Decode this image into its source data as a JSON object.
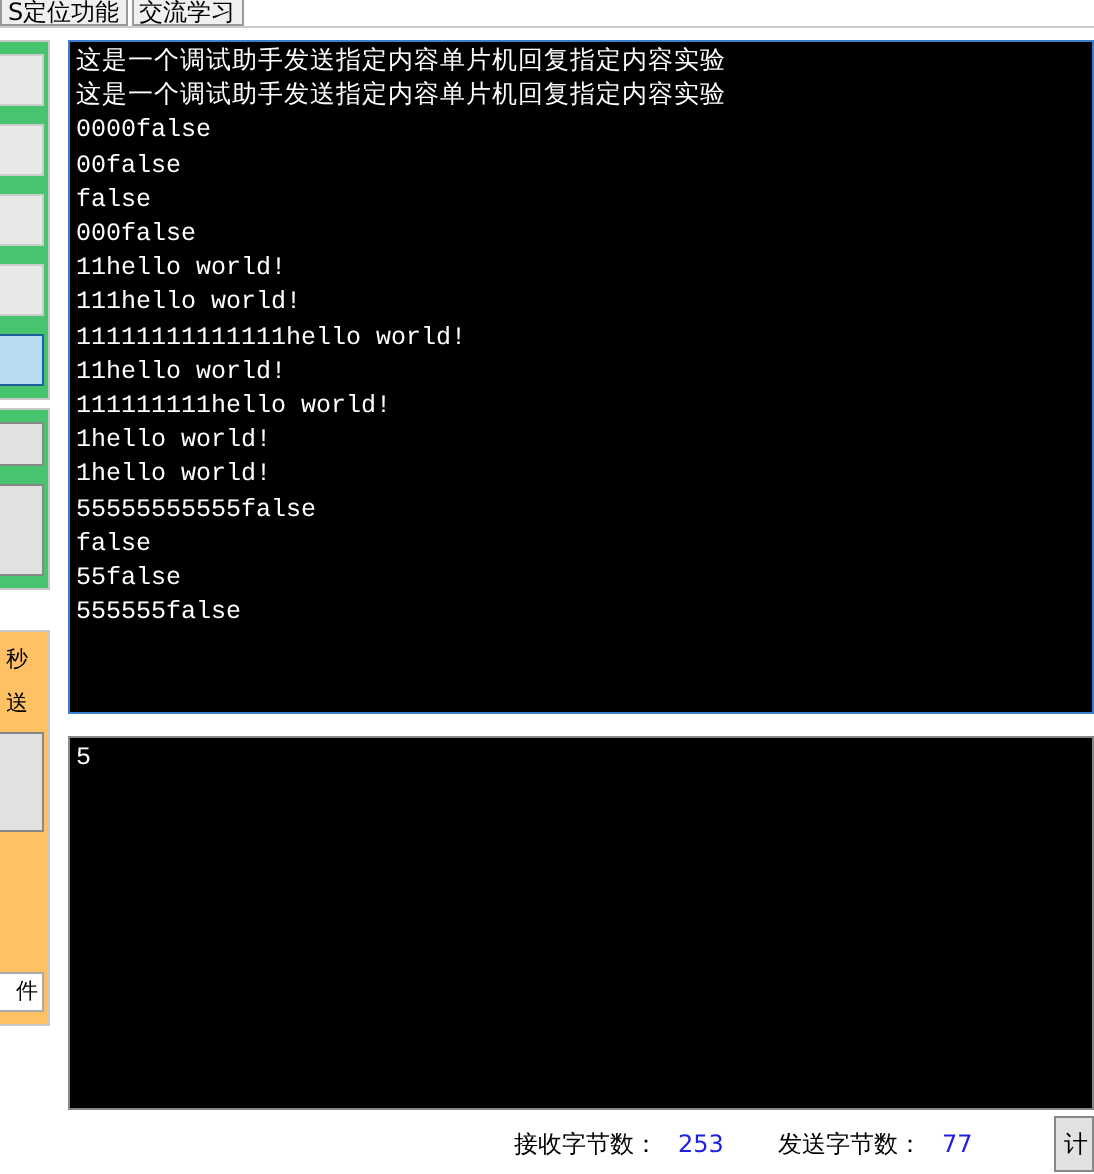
{
  "tabs": [
    {
      "label": "S定位功能",
      "selected": false
    },
    {
      "label": "交流学习",
      "selected": false
    }
  ],
  "left_panel": {
    "orange_panel": {
      "line_1": "秒",
      "line_2": "送",
      "field_value": "件"
    }
  },
  "receive_area": {
    "lines": [
      "这是一个调试助手发送指定内容单片机回复指定内容实验",
      "这是一个调试助手发送指定内容单片机回复指定内容实验",
      "0000false",
      "00false",
      "false",
      "000false",
      "11hello world!",
      "111hello world!",
      "11111111111111hello world!",
      "11hello world!",
      "111111111hello world!",
      "1hello world!",
      "1hello world!",
      "55555555555false",
      "false",
      "55false",
      "555555false"
    ]
  },
  "send_area": {
    "value": "5"
  },
  "status_bar": {
    "received_label": "接收字节数：",
    "received_count": "253",
    "sent_label": "发送字节数：",
    "sent_count": "77",
    "button": "计"
  }
}
